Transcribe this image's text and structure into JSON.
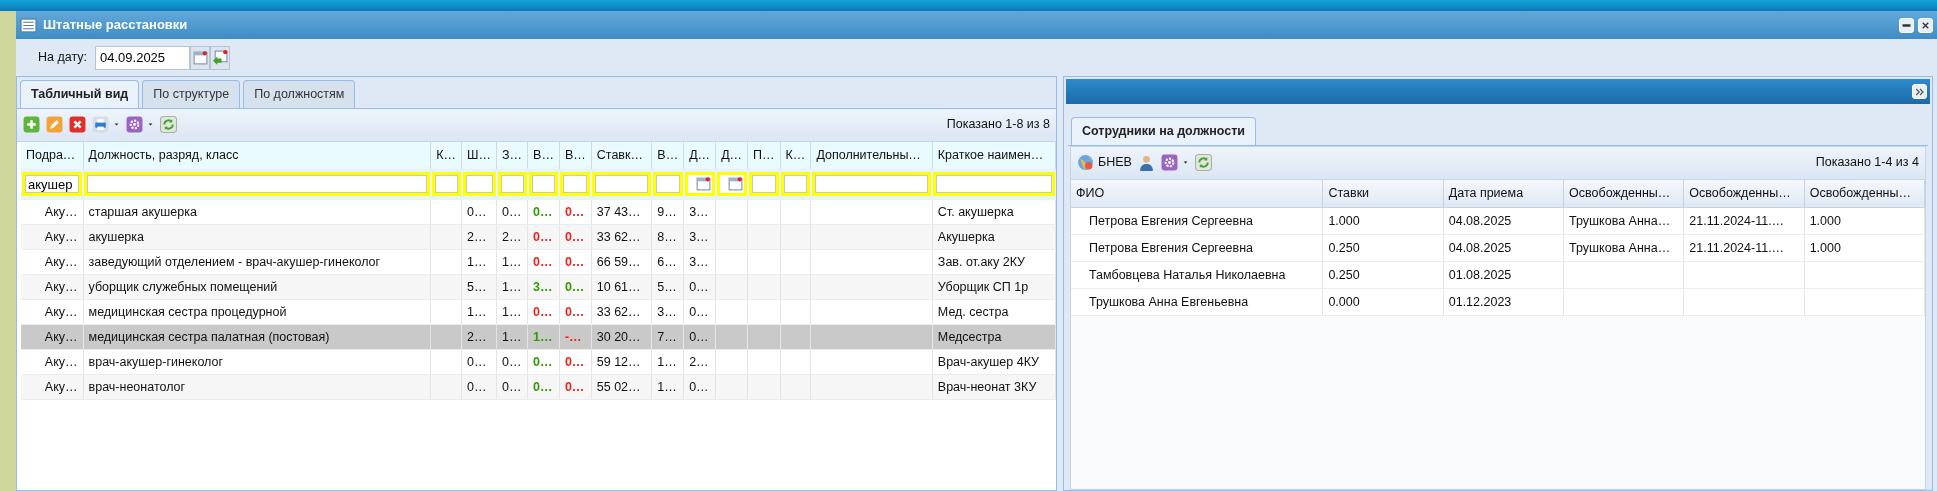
{
  "window": {
    "title": "Штатные расстановки"
  },
  "date_filter": {
    "label": "На дату:",
    "value": "04.09.2025"
  },
  "tabs": [
    {
      "label": "Табличный вид",
      "selected": true
    },
    {
      "label": "По структуре",
      "selected": false
    },
    {
      "label": "По должностям",
      "selected": false
    }
  ],
  "toolbar": {
    "pager": "Показано 1-8 из 8"
  },
  "table": {
    "columns": [
      {
        "label": "Подра…",
        "kind": "text",
        "filter_value": "акушер"
      },
      {
        "label": "Должность, разряд, класс",
        "kind": "text"
      },
      {
        "label": "К…",
        "kind": "text"
      },
      {
        "label": "Ш…",
        "kind": "text"
      },
      {
        "label": "З…",
        "kind": "text"
      },
      {
        "label": "В…",
        "kind": "text"
      },
      {
        "label": "В…",
        "kind": "text"
      },
      {
        "label": "Ставк…",
        "kind": "text"
      },
      {
        "label": "В…",
        "kind": "text"
      },
      {
        "label": "Д…",
        "kind": "date"
      },
      {
        "label": "Д…",
        "kind": "date"
      },
      {
        "label": "П…",
        "kind": "text"
      },
      {
        "label": "К…",
        "kind": "text"
      },
      {
        "label": "Дополнительны…",
        "kind": "text"
      },
      {
        "label": "Краткое наимен…",
        "kind": "text"
      }
    ],
    "rows": [
      {
        "selected": false,
        "cells": [
          "Аку…",
          "старшая акушерка",
          null,
          "0…",
          "0…",
          {
            "text": "0…",
            "color": "#339900"
          },
          {
            "text": "0…",
            "color": "#ee2222"
          },
          "37 43…",
          "9…",
          "3…",
          null,
          null,
          null,
          null,
          "Ст. акушерка"
        ]
      },
      {
        "selected": false,
        "cells": [
          "Аку…",
          "акушерка",
          null,
          "2…",
          "2…",
          {
            "text": "0…",
            "color": "#ee2222"
          },
          {
            "text": "0…",
            "color": "#ee2222"
          },
          "33 62…",
          "8…",
          "3…",
          null,
          null,
          null,
          null,
          "Акушерка"
        ]
      },
      {
        "selected": false,
        "cells": [
          "Аку…",
          "заведующий отделением - врач-акушер-гинеколог",
          null,
          "1…",
          "1…",
          {
            "text": "0…",
            "color": "#ee2222"
          },
          {
            "text": "0…",
            "color": "#ee2222"
          },
          "66 59…",
          "6…",
          "3…",
          null,
          null,
          null,
          null,
          "Зав. от.аку 2КУ"
        ]
      },
      {
        "selected": false,
        "cells": [
          "Аку…",
          "уборщик служебных помещений",
          null,
          "5…",
          "1…",
          {
            "text": "3…",
            "color": "#339900"
          },
          {
            "text": "0…",
            "color": "#339900"
          },
          "10 61…",
          "5…",
          "0…",
          null,
          null,
          null,
          null,
          "Уборщик СП 1р"
        ]
      },
      {
        "selected": false,
        "cells": [
          "Аку…",
          "медицинская сестра процедурной",
          null,
          "1…",
          "1…",
          {
            "text": "0…",
            "color": "#ee2222"
          },
          {
            "text": "0…",
            "color": "#ee2222"
          },
          "33 62…",
          "3…",
          "0…",
          null,
          null,
          null,
          null,
          "Мед. сестра"
        ]
      },
      {
        "selected": true,
        "cells": [
          "Аку…",
          "медицинская сестра палатная (постовая)",
          null,
          "2…",
          "1…",
          {
            "text": "1…",
            "color": "#339900"
          },
          {
            "text": "-…",
            "color": "#ee2222"
          },
          "30 20…",
          "7…",
          "0…",
          null,
          null,
          null,
          null,
          "Медсестра"
        ]
      },
      {
        "selected": false,
        "cells": [
          "Аку…",
          "врач-акушер-гинеколог",
          null,
          "0…",
          "0…",
          {
            "text": "0…",
            "color": "#339900"
          },
          {
            "text": "0…",
            "color": "#ee2222"
          },
          "59 12…",
          "1…",
          "2…",
          null,
          null,
          null,
          null,
          "Врач-акушер 4КУ"
        ]
      },
      {
        "selected": false,
        "cells": [
          "Аку…",
          "врач-неонатолог",
          null,
          "0…",
          "0…",
          {
            "text": "0…",
            "color": "#339900"
          },
          {
            "text": "0…",
            "color": "#ee2222"
          },
          "55 02…",
          "1…",
          "0…",
          null,
          null,
          null,
          null,
          "Врач-неонат 3КУ"
        ]
      }
    ]
  },
  "side_panel": {
    "tabs": [
      {
        "label": "Сотрудники на должности",
        "selected": true
      }
    ],
    "toolbar": {
      "user_label": "БНЕВ",
      "pager": "Показано 1-4 из 4"
    },
    "table": {
      "columns": [
        "ФИО",
        "Ставки",
        "Дата приема",
        "Освобожденны…",
        "Освобожденны…",
        "Освобожденны…"
      ],
      "rows": [
        [
          "Петрова Евгения Сергеевна",
          "1.000",
          "04.08.2025",
          "Трушкова Анна…",
          "21.11.2024-11.…",
          "1.000"
        ],
        [
          "Петрова Евгения Сергеевна",
          "0.250",
          "04.08.2025",
          "Трушкова Анна…",
          "21.11.2024-11.…",
          "1.000"
        ],
        [
          "Тамбовцева Наталья Николаевна",
          "0.250",
          "01.08.2025",
          null,
          null,
          null
        ],
        [
          "Трушкова Анна Евгеньевна",
          "0.000",
          "01.12.2023",
          null,
          null,
          null
        ]
      ]
    }
  }
}
